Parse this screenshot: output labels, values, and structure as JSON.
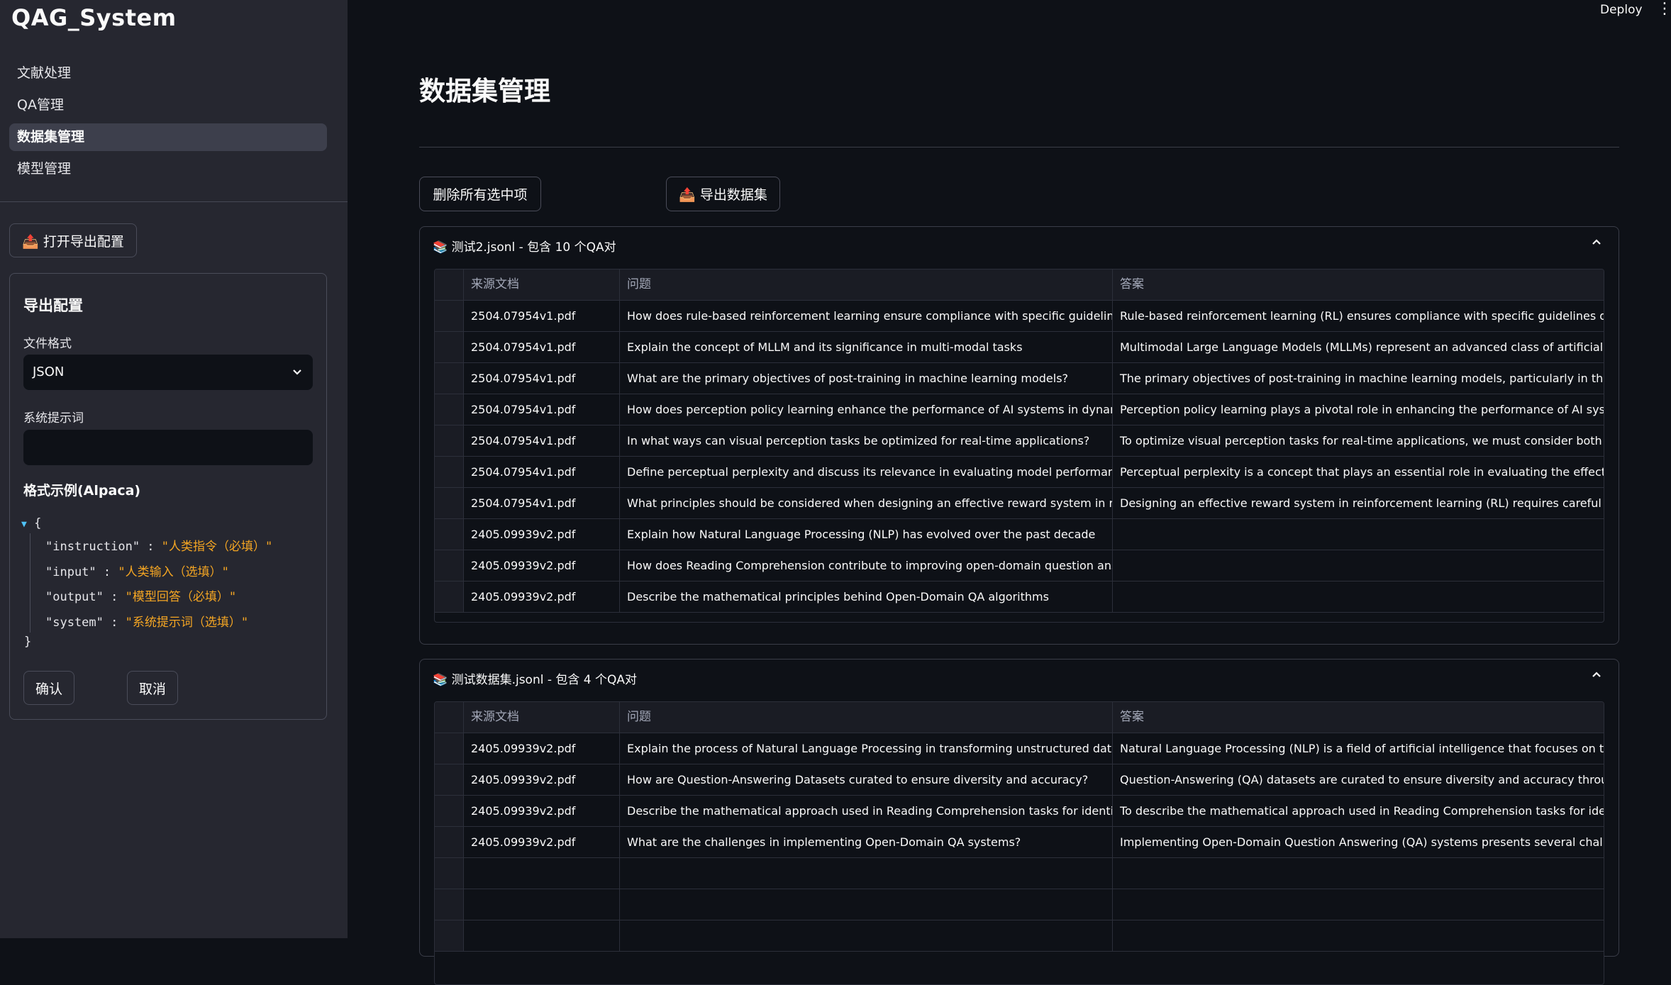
{
  "sidebar": {
    "app_title": "QAG_System",
    "nav": [
      {
        "label": "文献处理",
        "active": false
      },
      {
        "label": "QA管理",
        "active": false
      },
      {
        "label": "数据集管理",
        "active": true
      },
      {
        "label": "模型管理",
        "active": false
      }
    ],
    "open_export_button": "📤 打开导出配置",
    "export_config": {
      "title": "导出配置",
      "file_format_label": "文件格式",
      "file_format_value": "JSON",
      "system_prompt_label": "系统提示词",
      "system_prompt_value": "",
      "example_label": "格式示例(Alpaca)",
      "json_open": "{",
      "json_close": "}",
      "json_lines": [
        {
          "key": "\"instruction\"",
          "value": "\"人类指令（必填）\""
        },
        {
          "key": "\"input\"",
          "value": "\"人类输入（选填）\""
        },
        {
          "key": "\"output\"",
          "value": "\"模型回答（必填）\""
        },
        {
          "key": "\"system\"",
          "value": "\"系统提示词（选填）\""
        }
      ],
      "confirm_button": "确认",
      "cancel_button": "取消"
    }
  },
  "topbar": {
    "deploy": "Deploy",
    "menu_icon": "⋮"
  },
  "main": {
    "title": "数据集管理",
    "delete_button": "删除所有选中项",
    "export_button": "📤 导出数据集",
    "columns": [
      "来源文档",
      "问题",
      "答案"
    ],
    "datasets": [
      {
        "header": "📚 测试2.jsonl - 包含 10 个QA对",
        "rows": [
          [
            "2504.07954v1.pdf",
            "How does rule-based reinforcement learning ensure compliance with specific guidelines during",
            "Rule-based reinforcement learning (RL) ensures compliance with specific guidelines during tra"
          ],
          [
            "2504.07954v1.pdf",
            "Explain the concept of MLLM and its significance in multi-modal tasks",
            "Multimodal Large Language Models (MLLMs) represent an advanced class of artificial intelligen"
          ],
          [
            "2504.07954v1.pdf",
            "What are the primary objectives of post-training in machine learning models?",
            "The primary objectives of post-training in machine learning models, particularly in the context"
          ],
          [
            "2504.07954v1.pdf",
            "How does perception policy learning enhance the performance of AI systems in dynamic envirc",
            "Perception policy learning plays a pivotal role in enhancing the performance of AI systems, par"
          ],
          [
            "2504.07954v1.pdf",
            "In what ways can visual perception tasks be optimized for real-time applications?",
            "To optimize visual perception tasks for real-time applications, we must consider both the theor"
          ],
          [
            "2504.07954v1.pdf",
            "Define perceptual perplexity and discuss its relevance in evaluating model performance",
            "Perceptual perplexity is a concept that plays an essential role in evaluating the effectiveness of"
          ],
          [
            "2504.07954v1.pdf",
            "What principles should be considered when designing an effective reward system in reinforcem",
            "Designing an effective reward system in reinforcement learning (RL) requires careful considera"
          ],
          [
            "2405.09939v2.pdf",
            "Explain how Natural Language Processing (NLP) has evolved over the past decade",
            ""
          ],
          [
            "2405.09939v2.pdf",
            "How does Reading Comprehension contribute to improving open-domain question answering",
            ""
          ],
          [
            "2405.09939v2.pdf",
            "Describe the mathematical principles behind Open-Domain QA algorithms",
            ""
          ]
        ]
      },
      {
        "header": "📚 测试数据集.jsonl - 包含 4 个QA对",
        "rows": [
          [
            "2405.09939v2.pdf",
            "Explain the process of Natural Language Processing in transforming unstructured data into stru",
            "Natural Language Processing (NLP) is a field of artificial intelligence that focuses on the interac"
          ],
          [
            "2405.09939v2.pdf",
            "How are Question-Answering Datasets curated to ensure diversity and accuracy?",
            "Question-Answering (QA) datasets are curated to ensure diversity and accuracy through a coml"
          ],
          [
            "2405.09939v2.pdf",
            "Describe the mathematical approach used in Reading Comprehension tasks for identifying con",
            "To describe the mathematical approach used in Reading Comprehension tasks for identifying c"
          ],
          [
            "2405.09939v2.pdf",
            "What are the challenges in implementing Open-Domain QA systems?",
            "Implementing Open-Domain Question Answering (QA) systems presents several challenges, as"
          ],
          [
            "",
            "",
            ""
          ],
          [
            "",
            "",
            ""
          ],
          [
            "",
            "",
            ""
          ]
        ]
      }
    ]
  }
}
